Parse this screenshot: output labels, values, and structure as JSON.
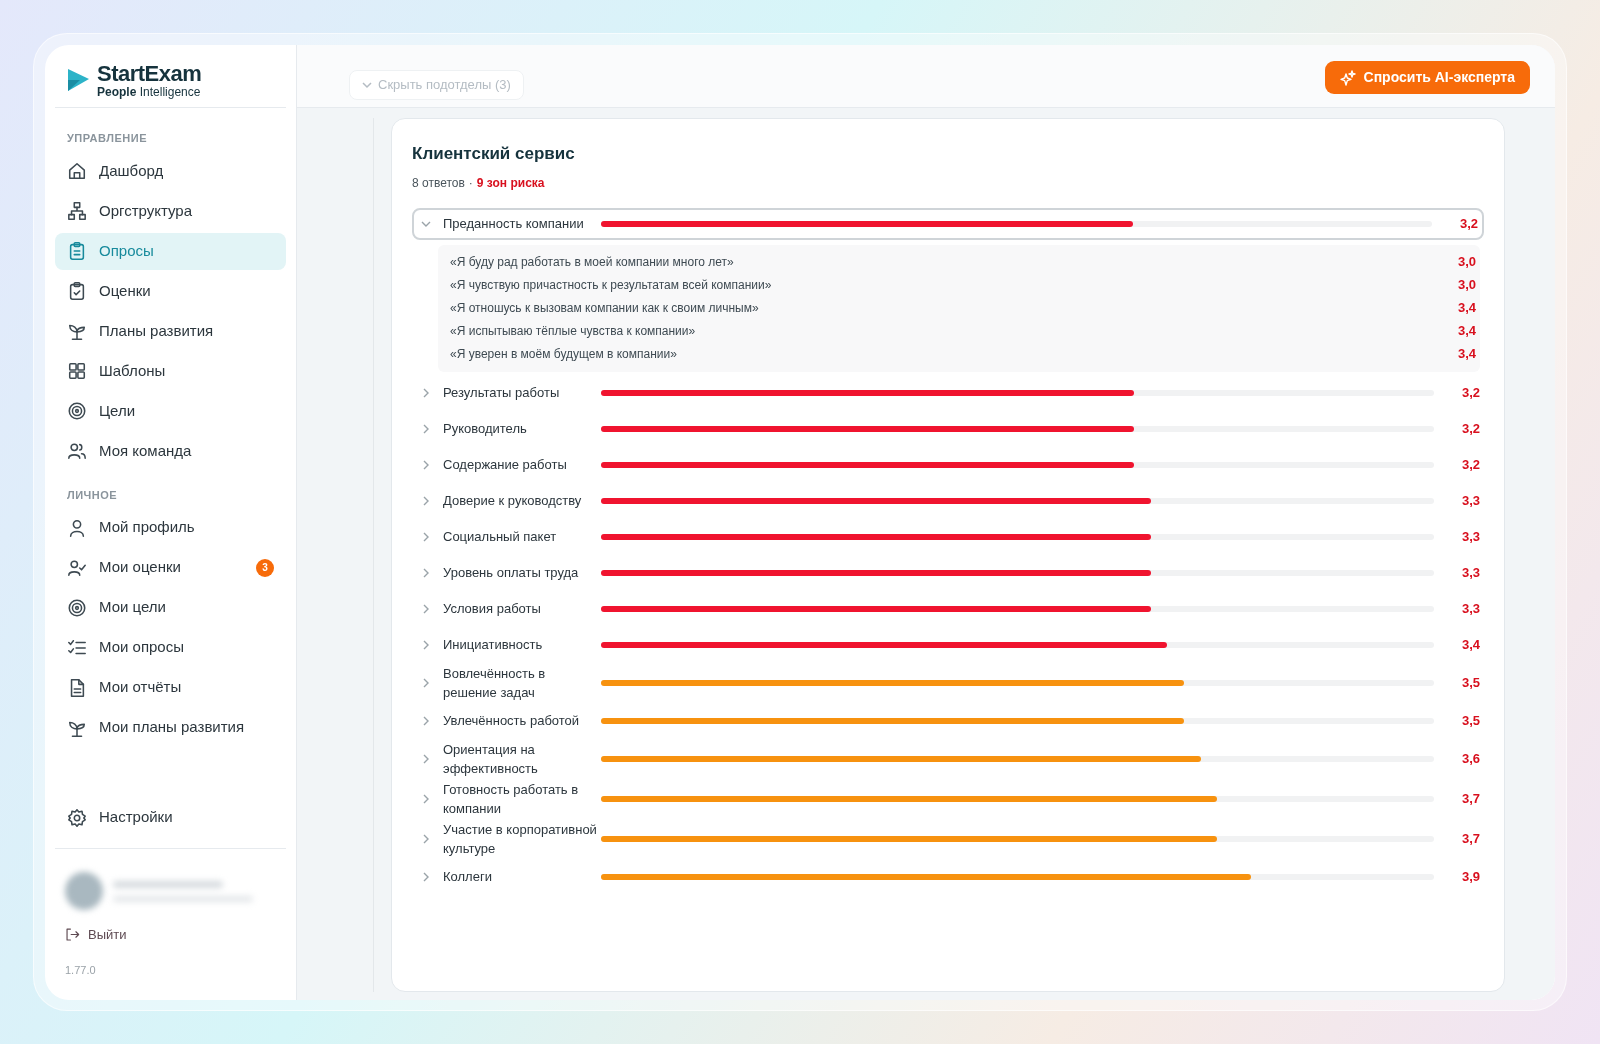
{
  "brand": {
    "name": "StartExam",
    "tagline": "**People** Intelligence"
  },
  "sidebar": {
    "sections": [
      {
        "title": "УПРАВЛЕНИЕ",
        "items": [
          {
            "label": "Дашборд",
            "selected": false
          },
          {
            "label": "Оргструктура",
            "selected": false
          },
          {
            "label": "Опросы",
            "selected": true
          },
          {
            "label": "Оценки",
            "selected": false
          },
          {
            "label": "Планы развития",
            "selected": false
          },
          {
            "label": "Шаблоны",
            "selected": false
          },
          {
            "label": "Цели",
            "selected": false
          },
          {
            "label": "Моя команда",
            "selected": false
          }
        ]
      },
      {
        "title": "ЛИЧНОЕ",
        "items": [
          {
            "label": "Мой профиль",
            "selected": false
          },
          {
            "label": "Мои оценки",
            "selected": false,
            "badge": "3"
          },
          {
            "label": "Мои цели",
            "selected": false
          },
          {
            "label": "Мои опросы",
            "selected": false
          },
          {
            "label": "Мои отчёты",
            "selected": false
          },
          {
            "label": "Мои планы развития",
            "selected": false
          }
        ]
      }
    ],
    "settings": "Настройки",
    "logout": "Выйти",
    "version": "1.77.0"
  },
  "header": {
    "collapse": "Скрыть подотделы (3)",
    "ai_button": "Спросить AI-эксперта"
  },
  "card": {
    "title": "Клиентский сервис",
    "responses": "8 ответов",
    "separator": "·",
    "risks": "9 зон риска",
    "factors": [
      {
        "label": "Преданность компании",
        "expanded": true,
        "level": 0.64,
        "color": "#f0142f",
        "score": "3,2",
        "statements": [
          {
            "text": "«Я буду рад работать в моей компании много лет»",
            "score": "3,0"
          },
          {
            "text": "«Я чувствую причастность к результатам всей компании»",
            "score": "3,0"
          },
          {
            "text": "«Я отношусь к вызовам компании как к своим личным»",
            "score": "3,4"
          },
          {
            "text": "«Я испытываю тёплые чувства к компании»",
            "score": "3,4"
          },
          {
            "text": "«Я уверен в моём будущем в компании»",
            "score": "3,4"
          }
        ]
      },
      {
        "label": "Результаты работы",
        "expanded": false,
        "level": 0.64,
        "color": "#f0142f",
        "score": "3,2"
      },
      {
        "label": "Руководитель",
        "expanded": false,
        "level": 0.64,
        "color": "#f0142f",
        "score": "3,2"
      },
      {
        "label": "Содержание работы",
        "expanded": false,
        "level": 0.64,
        "color": "#f0142f",
        "score": "3,2"
      },
      {
        "label": "Доверие к руководству",
        "expanded": false,
        "level": 0.66,
        "color": "#f0142f",
        "score": "3,3"
      },
      {
        "label": "Социальный пакет",
        "expanded": false,
        "level": 0.66,
        "color": "#f0142f",
        "score": "3,3"
      },
      {
        "label": "Уровень оплаты труда",
        "expanded": false,
        "level": 0.66,
        "color": "#f0142f",
        "score": "3,3"
      },
      {
        "label": "Условия работы",
        "expanded": false,
        "level": 0.66,
        "color": "#f0142f",
        "score": "3,3"
      },
      {
        "label": "Инициативность",
        "expanded": false,
        "level": 0.68,
        "color": "#f0142f",
        "score": "3,4"
      },
      {
        "label": "Вовлечённость в решение задач",
        "expanded": false,
        "level": 0.7,
        "color": "#f7920f",
        "score": "3,5"
      },
      {
        "label": "Увлечённость работой",
        "expanded": false,
        "level": 0.7,
        "color": "#f7920f",
        "score": "3,5"
      },
      {
        "label": "Ориентация на эффективность",
        "expanded": false,
        "level": 0.72,
        "color": "#f7920f",
        "score": "3,6"
      },
      {
        "label": "Готовность работать в компании",
        "expanded": false,
        "level": 0.74,
        "color": "#f7920f",
        "score": "3,7"
      },
      {
        "label": "Участие в корпоративной культуре",
        "expanded": false,
        "level": 0.74,
        "color": "#f7920f",
        "score": "3,7"
      },
      {
        "label": "Коллеги",
        "expanded": false,
        "level": 0.78,
        "color": "#f7920f",
        "score": "3,9"
      }
    ]
  }
}
